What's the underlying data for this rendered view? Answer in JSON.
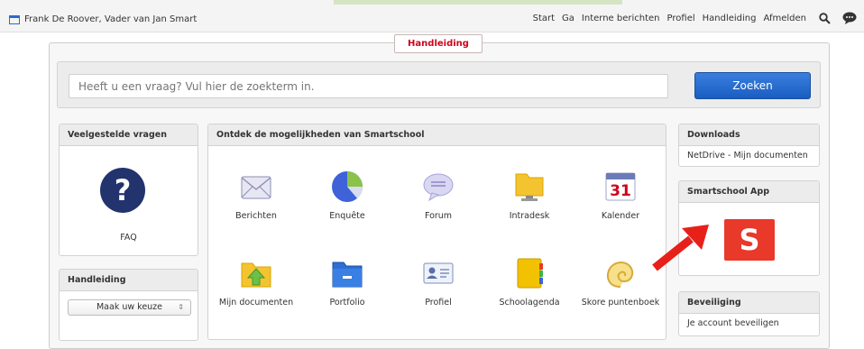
{
  "header": {
    "user": "Frank De Roover, Vader van Jan Smart",
    "nav": [
      "Start",
      "Ga",
      "Interne berichten",
      "Profiel",
      "Handleiding",
      "Afmelden"
    ]
  },
  "tab_label": "Handleiding",
  "search": {
    "placeholder": "Heeft u een vraag? Vul hier de zoekterm in.",
    "button": "Zoeken"
  },
  "faq_panel": {
    "title": "Veelgestelde vragen",
    "label": "FAQ",
    "icon": "question-icon"
  },
  "handleiding_panel": {
    "title": "Handleiding",
    "select_value": "Maak uw keuze"
  },
  "main_panel": {
    "title": "Ontdek de mogelijkheden van Smartschool",
    "apps": [
      {
        "label": "Berichten",
        "icon": "envelope-icon"
      },
      {
        "label": "Enquête",
        "icon": "pie-chart-icon"
      },
      {
        "label": "Forum",
        "icon": "speech-bubble-icon"
      },
      {
        "label": "Intradesk",
        "icon": "folder-monitor-icon"
      },
      {
        "label": "Kalender",
        "icon": "calendar-icon",
        "day": "31"
      },
      {
        "label": "Mijn documenten",
        "icon": "folder-upload-icon"
      },
      {
        "label": "Portfolio",
        "icon": "blue-folder-icon"
      },
      {
        "label": "Profiel",
        "icon": "id-card-icon"
      },
      {
        "label": "Schoolagenda",
        "icon": "agenda-icon"
      },
      {
        "label": "Skore puntenboek",
        "icon": "shell-icon"
      }
    ]
  },
  "downloads_panel": {
    "title": "Downloads",
    "item": "NetDrive - Mijn documenten"
  },
  "app_panel": {
    "title": "Smartschool App",
    "logo_letter": "S"
  },
  "security_panel": {
    "title": "Beveiliging",
    "item": "Je account beveiligen"
  },
  "colors": {
    "accent": "#1a5dc2",
    "tab_text": "#d0021b",
    "app_logo": "#e8392b",
    "arrow": "#e8201a"
  }
}
